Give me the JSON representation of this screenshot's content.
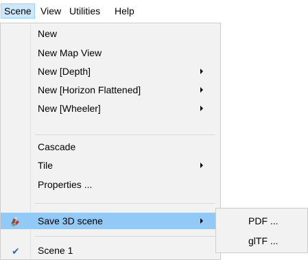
{
  "menubar": {
    "items": [
      {
        "label": "Scene"
      },
      {
        "label": "View"
      },
      {
        "label": "Utilities"
      },
      {
        "label": "Help"
      }
    ]
  },
  "dropdown": {
    "items": [
      {
        "label": "New"
      },
      {
        "label": "New Map View"
      },
      {
        "label": "New [Depth]",
        "submenu": true
      },
      {
        "label": "New [Horizon Flattened]",
        "submenu": true
      },
      {
        "label": "New [Wheeler]",
        "submenu": true
      },
      {
        "label": "Cascade"
      },
      {
        "label": "Tile",
        "submenu": true
      },
      {
        "label": "Properties ..."
      },
      {
        "label": "Save 3D scene",
        "submenu": true,
        "icon": "save-3d-scene-icon",
        "highlighted": true
      },
      {
        "label": "Scene 1",
        "checked": true
      }
    ]
  },
  "submenu": {
    "items": [
      {
        "label": "PDF ..."
      },
      {
        "label": "glTF ..."
      }
    ]
  },
  "colors": {
    "highlight": "#91c9f7",
    "menubar_active": "#cce8ff",
    "menu_background": "#f2f2f2"
  }
}
